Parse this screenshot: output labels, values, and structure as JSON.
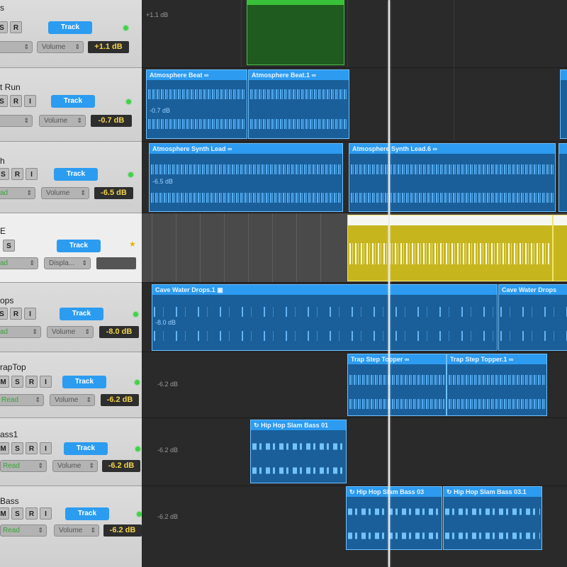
{
  "headers": [
    {
      "name": "s",
      "buttons": [
        "S",
        "R"
      ],
      "track_label": "Track",
      "read": "",
      "param": "Volume",
      "value": "+1.1 dB",
      "indicator": "led"
    },
    {
      "name": "t Run",
      "buttons": [
        "S",
        "R",
        "I"
      ],
      "track_label": "Track",
      "read": "",
      "param": "Volume",
      "value": "-0.7 dB",
      "indicator": "led"
    },
    {
      "name": "h",
      "buttons": [
        "S",
        "R",
        "I"
      ],
      "track_label": "Track",
      "read": "ad",
      "param": "Volume",
      "value": "-6.5 dB",
      "indicator": "led"
    },
    {
      "name": "E",
      "buttons": [
        "S"
      ],
      "track_label": "Track",
      "read": "ad",
      "param": "Displa...",
      "value": "",
      "indicator": "star"
    },
    {
      "name": "ops",
      "buttons": [
        "S",
        "R",
        "I"
      ],
      "track_label": "Track",
      "read": "ad",
      "param": "Volume",
      "value": "-8.0 dB",
      "indicator": "led"
    },
    {
      "name": "rapTop",
      "buttons": [
        "M",
        "S",
        "R",
        "I"
      ],
      "track_label": "Track",
      "read": "Read",
      "param": "Volume",
      "value": "-6.2 dB",
      "indicator": "led"
    },
    {
      "name": "ass1",
      "buttons": [
        "M",
        "S",
        "R",
        "I"
      ],
      "track_label": "Track",
      "read": "Read",
      "param": "Volume",
      "value": "-6.2 dB",
      "indicator": "led"
    },
    {
      "name": "Bass",
      "buttons": [
        "M",
        "S",
        "R",
        "I"
      ],
      "track_label": "Track",
      "read": "Read",
      "param": "Volume",
      "value": "-6.2 dB",
      "indicator": "led"
    }
  ],
  "lane_labels": [
    "+1.1 dB",
    "-6.2 dB",
    "-6.2 dB",
    "-6.2 dB"
  ],
  "regions": [
    {
      "name": "Atmosphere Beat",
      "db": "-0.7 dB"
    },
    {
      "name": "Atmosphere Beat.1",
      "db": ""
    },
    {
      "name": "Atmosphere Synth Lead",
      "db": "-6.5 dB"
    },
    {
      "name": "Atmosphere Synth Lead.6",
      "db": ""
    },
    {
      "name": "",
      "db": ""
    },
    {
      "name": "Cave Water Drops.1",
      "db": "-8.0 dB"
    },
    {
      "name": "Cave Water Drops",
      "db": ""
    },
    {
      "name": "Trap Step Topper",
      "db": ""
    },
    {
      "name": "Trap Step Topper.1",
      "db": ""
    },
    {
      "name": "Hip Hop Slam Bass 01",
      "db": ""
    },
    {
      "name": "Hip Hop Slam Bass 03",
      "db": ""
    },
    {
      "name": "Hip Hop Slam Bass 03.1",
      "db": ""
    }
  ],
  "colors": {
    "track_button": "#2c9cf0",
    "region_blue": "#2c9bf0",
    "region_gold": "#c7b51e",
    "region_green": "#39c039",
    "value_text": "#f2d24a",
    "led": "#42d24a"
  }
}
